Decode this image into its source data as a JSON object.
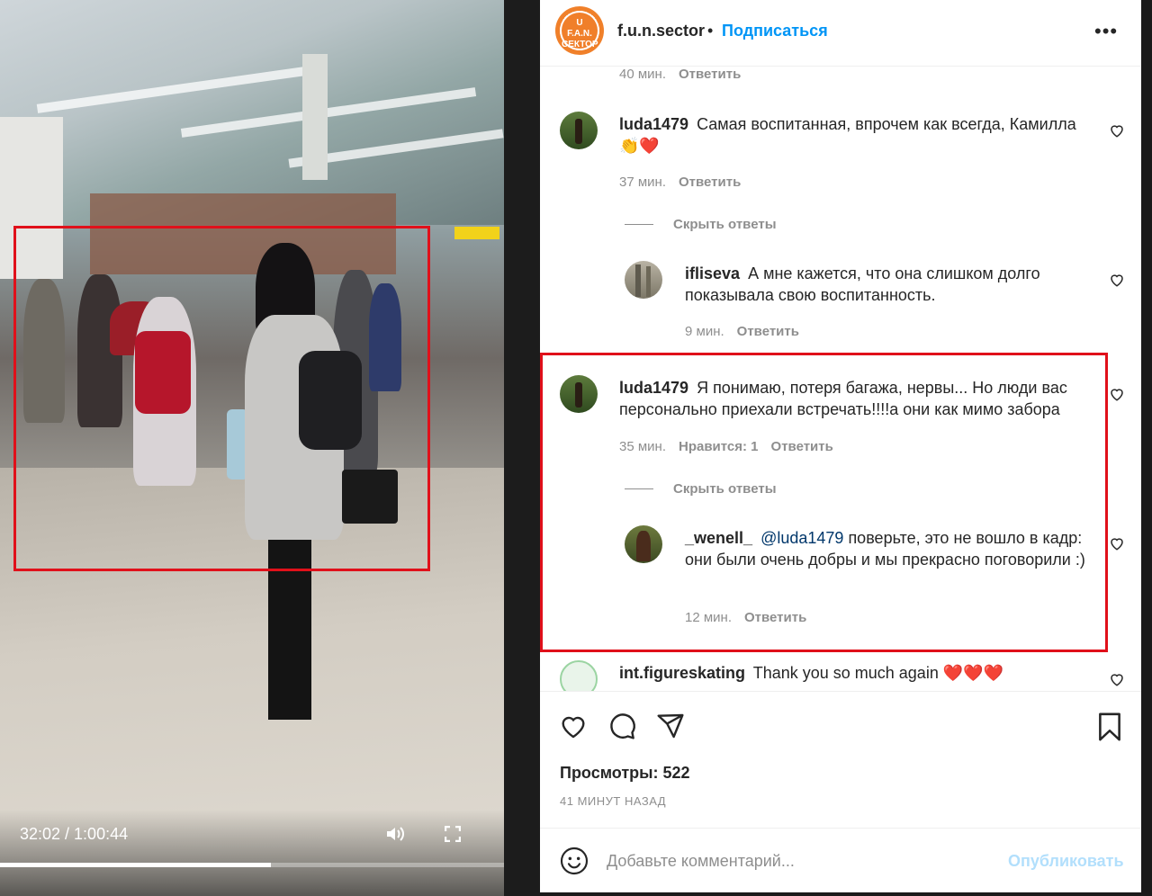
{
  "video": {
    "time_label": "32:02 / 1:00:44",
    "progress_fraction": 0.52,
    "icons": {
      "volume": "volume-icon",
      "fullscreen": "fullscreen-icon",
      "more": "kebab-menu-icon"
    }
  },
  "post": {
    "author": "f.u.n.sector",
    "separator": "•",
    "follow_label": "Подписаться",
    "more_label": "•••",
    "avatar_text": "U F.A.N. СЕКТОР"
  },
  "comments": {
    "top_meta": {
      "time": "40 мин.",
      "reply": "Ответить"
    },
    "c1": {
      "user": "luda1479",
      "text": "Самая воспитанная, впрочем как всегда, Камилла",
      "emoji": "👏❤️",
      "time": "37 мин.",
      "reply": "Ответить",
      "hide": "Скрыть ответы"
    },
    "c1r1": {
      "user": "ifliseva",
      "text": "А мне кажется, что она слишком долго показывала свою воспитанность.",
      "time": "9 мин.",
      "reply": "Ответить"
    },
    "c2": {
      "user": "luda1479",
      "text": "Я понимаю, потеря багажа, нервы... Но люди вас персонально приехали встречать!!!!а они как мимо забора",
      "time": "35 мин.",
      "likes": "Нравится: 1",
      "reply": "Ответить",
      "hide": "Скрыть ответы"
    },
    "c2r1": {
      "user": "_wenell_",
      "mention": "@luda1479",
      "text": "поверьте, это не вошло в кадр: они были очень добры и мы прекрасно поговорили :)",
      "time": "12 мин.",
      "reply": "Ответить"
    },
    "c3": {
      "user": "int.figureskating",
      "text": "Thank you so much again",
      "emoji": "❤️❤️❤️"
    }
  },
  "footer": {
    "views_label": "Просмотры: 522",
    "posted_ago": "41 МИНУТ НАЗАД",
    "comment_placeholder": "Добавьте комментарий...",
    "publish_label": "Опубликовать"
  },
  "colors": {
    "accent": "#0095f6",
    "highlight_box": "#e0101a",
    "text": "#262626",
    "muted": "#8e8e8e"
  }
}
